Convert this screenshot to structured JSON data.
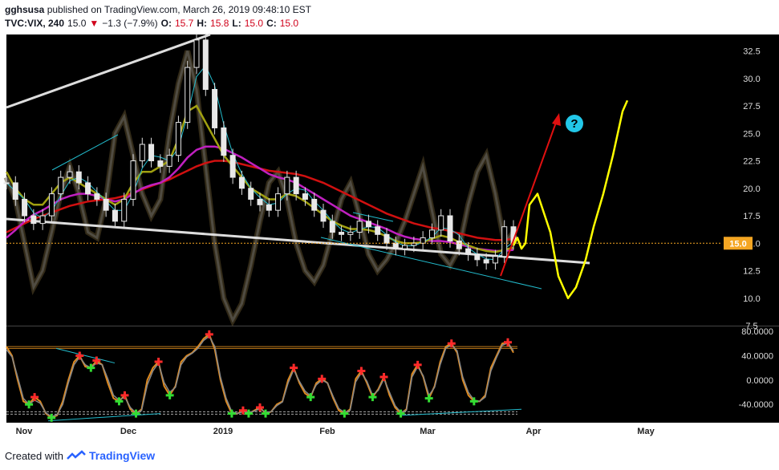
{
  "header": {
    "user": "gghsusa",
    "published": "published on TradingView.com, March 26, 2019 09:48:10 EST",
    "symbol": "TVC:VIX, 240",
    "last": "15.0",
    "down_arrow": "▼",
    "change": "−1.3 (−7.9%)",
    "o_label": "O:",
    "o_value": "15.7",
    "h_label": "H:",
    "h_value": "15.8",
    "l_label": "L:",
    "l_value": "15.0",
    "c_label": "C:",
    "c_value": "15.0"
  },
  "footer": {
    "created_with": "Created with",
    "brand": "TradingView"
  },
  "price_badge": "15.0",
  "question_mark": "?",
  "colors": {
    "background": "#000000",
    "price_line": "#f5a623",
    "badge": "#f5a623",
    "magenta_ma": "#c020c0",
    "red_ma": "#d01010",
    "olive_ma": "#a0a010",
    "cyan_ma": "#22bbcc",
    "projection": "#ffff00",
    "arrow": "#e01010"
  },
  "chart_data": [
    {
      "type": "line",
      "title": "",
      "xlabel": "",
      "ylabel": "",
      "ylim": [
        7.5,
        34
      ],
      "y_ticks": [
        "32.5",
        "30.0",
        "27.5",
        "25.0",
        "22.5",
        "20.0",
        "17.5",
        "15.0",
        "12.5",
        "10.0",
        "7.5"
      ],
      "x_ticks": [
        "Nov",
        "Dec",
        "2019",
        "Feb",
        "Mar",
        "Apr",
        "May"
      ],
      "current_price": 15.0,
      "series": [
        {
          "values": [
            20.5,
            19.0,
            17.5,
            16.8,
            17.5,
            19.5,
            21.0,
            21.5,
            20.5,
            19.5,
            19.0,
            18.0,
            17.0,
            19.0,
            22.5,
            24.0,
            22.5,
            22.0,
            23.0,
            26.0,
            31.0,
            33.5,
            29.0,
            25.5,
            23.0,
            21.0,
            20.0,
            19.0,
            18.5,
            18.0,
            19.5,
            21.0,
            19.5,
            19.0,
            18.0,
            17.0,
            16.0,
            15.8,
            16.0,
            17.0,
            16.5,
            15.8,
            15.0,
            14.5,
            14.8,
            15.0,
            15.5,
            16.2,
            17.5,
            15.2,
            14.5,
            14.0,
            13.5,
            13.2,
            13.8,
            16.5,
            15.0
          ]
        },
        {
          "values": [
            21.5,
            20.0,
            19.0,
            18.5,
            18.5,
            19.5,
            20.5,
            21.0,
            20.5,
            20.0,
            19.5,
            19.0,
            18.5,
            19.0,
            20.5,
            21.5,
            21.5,
            22.0,
            22.5,
            24.5,
            27.0,
            27.5,
            26.0,
            24.5,
            23.0,
            22.0,
            21.0,
            20.0,
            19.5,
            19.0,
            19.0,
            19.5,
            19.3,
            18.8,
            18.2,
            17.6,
            17.0,
            16.6,
            16.3,
            16.3,
            16.2,
            16.0,
            15.6,
            15.2,
            15.0,
            15.0,
            15.1,
            15.4,
            15.7,
            15.5,
            15.1,
            14.8,
            14.5,
            14.3,
            14.2,
            14.4,
            14.6
          ]
        },
        {
          "values": [
            15.5,
            16.2,
            17.0,
            17.6,
            18.0,
            18.5,
            19.0,
            19.3,
            19.5,
            19.5,
            19.3,
            19.0,
            18.8,
            19.0,
            19.5,
            20.0,
            20.3,
            20.5,
            21.0,
            21.8,
            22.8,
            23.5,
            23.8,
            23.8,
            23.6,
            23.2,
            22.8,
            22.3,
            21.8,
            21.3,
            21.0,
            20.8,
            20.5,
            20.0,
            19.5,
            19.0,
            18.5,
            18.0,
            17.5,
            17.2,
            16.9,
            16.6,
            16.3,
            15.9,
            15.6,
            15.4,
            15.3,
            15.2,
            15.2,
            15.1,
            14.9,
            14.7,
            14.5,
            14.4,
            14.3,
            14.3,
            14.4
          ]
        },
        {
          "values": [
            16.0,
            16.4,
            16.8,
            17.2,
            17.5,
            17.8,
            18.1,
            18.4,
            18.6,
            18.8,
            18.9,
            19.0,
            19.1,
            19.3,
            19.6,
            19.9,
            20.2,
            20.5,
            20.8,
            21.2,
            21.6,
            22.0,
            22.3,
            22.5,
            22.5,
            22.4,
            22.2,
            22.0,
            21.8,
            21.6,
            21.5,
            21.4,
            21.3,
            21.1,
            20.8,
            20.5,
            20.1,
            19.7,
            19.3,
            18.9,
            18.5,
            18.1,
            17.7,
            17.4,
            17.1,
            16.8,
            16.6,
            16.4,
            16.3,
            16.1,
            15.9,
            15.7,
            15.5,
            15.4,
            15.3,
            15.3,
            15.4
          ]
        },
        {
          "values": [
            null,
            null,
            null,
            null,
            null,
            null,
            null,
            null,
            null,
            null,
            null,
            null,
            null,
            null,
            null,
            null,
            null,
            null,
            null,
            null,
            null,
            null,
            null,
            null,
            null,
            null,
            null,
            null,
            null,
            null,
            null,
            null,
            null,
            null,
            null,
            null,
            null,
            null,
            null,
            null,
            null,
            null,
            null,
            null,
            null,
            null,
            null,
            null,
            null,
            null,
            null,
            null,
            null,
            null,
            null,
            null,
            14.8,
            15.5,
            14.5,
            15.0,
            18.5,
            19.5,
            16.0,
            12.0,
            10.0,
            11.0,
            13.5,
            16.5,
            19.5,
            23.0,
            27.0,
            28.0
          ]
        },
        {
          "values": [
            21.0,
            19.0,
            15.0,
            11.0,
            12.5,
            16.0,
            19.5,
            22.0,
            19.5,
            16.0,
            15.5,
            19.0,
            25.0,
            26.5,
            23.0,
            19.5,
            17.5,
            19.0,
            25.0,
            29.5,
            32.5,
            29.0,
            22.0,
            15.0,
            10.0,
            8.0,
            9.5,
            13.0,
            17.0,
            20.5,
            21.5,
            19.0,
            15.0,
            12.5,
            11.5,
            13.0,
            16.0,
            19.0,
            20.5,
            17.5,
            14.0,
            12.5,
            13.5,
            15.0,
            17.0,
            19.5,
            22.0,
            18.0,
            14.0,
            13.0,
            14.5,
            18.5,
            21.5,
            23.0,
            19.5,
            15.0,
            16.0
          ]
        }
      ]
    },
    {
      "type": "line",
      "title": "",
      "xlabel": "",
      "ylabel": "",
      "ylim": [
        -70,
        88
      ],
      "y_ticks": [
        "80.0000",
        "40.0000",
        "0.0000",
        "-40.0000"
      ],
      "levels": [
        55,
        52,
        -52,
        -56
      ],
      "series": [
        {
          "values": [
            55,
            40,
            0,
            -35,
            -40,
            -28,
            -35,
            -55,
            -62,
            -58,
            -35,
            0,
            30,
            40,
            22,
            20,
            32,
            25,
            -5,
            -30,
            -35,
            -25,
            -48,
            -55,
            -48,
            0,
            20,
            30,
            -10,
            -25,
            -10,
            30,
            40,
            45,
            55,
            68,
            75,
            50,
            0,
            -35,
            -55,
            -55,
            -50,
            -55,
            -50,
            -45,
            -55,
            -52,
            -40,
            -35,
            0,
            20,
            -5,
            -22,
            -28,
            -5,
            2,
            -5,
            -30,
            -50,
            -55,
            -48,
            2,
            15,
            -5,
            -28,
            -15,
            5,
            -25,
            -45,
            -55,
            -48,
            10,
            25,
            5,
            -30,
            -10,
            30,
            55,
            60,
            45,
            0,
            -25,
            -35,
            -35,
            -25,
            20,
            40,
            60,
            62,
            45
          ]
        },
        {
          "values": [
            50,
            38,
            5,
            -30,
            -40,
            -33,
            -38,
            -54,
            -60,
            -57,
            -40,
            -5,
            25,
            38,
            25,
            20,
            28,
            25,
            2,
            -25,
            -33,
            -28,
            -45,
            -54,
            -50,
            -8,
            15,
            28,
            -4,
            -20,
            -12,
            25,
            38,
            44,
            52,
            65,
            72,
            55,
            5,
            -30,
            -52,
            -55,
            -52,
            -53,
            -51,
            -47,
            -53,
            -52,
            -42,
            -36,
            -5,
            17,
            -2,
            -18,
            -26,
            -8,
            0,
            -5,
            -27,
            -47,
            -53,
            -50,
            -3,
            12,
            -2,
            -25,
            -17,
            2,
            -20,
            -42,
            -53,
            -50,
            5,
            22,
            7,
            -25,
            -12,
            25,
            52,
            58,
            48,
            5,
            -20,
            -33,
            -35,
            -28,
            15,
            37,
            57,
            61,
            48
          ]
        }
      ]
    }
  ]
}
